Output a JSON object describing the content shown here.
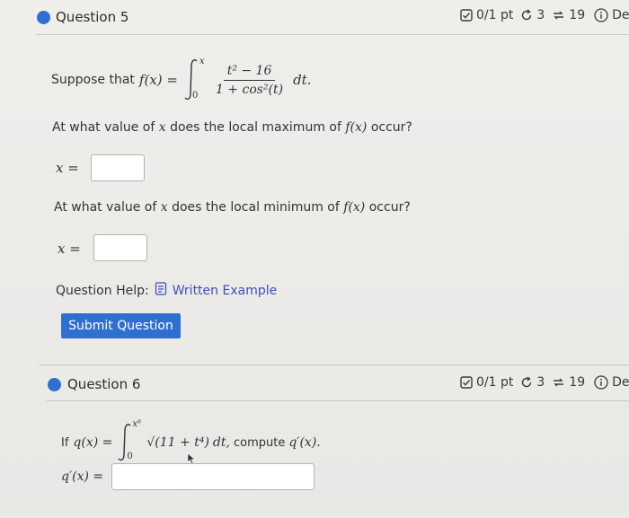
{
  "q5": {
    "title": "Question 5",
    "score": "0/1 pt",
    "retries": "3",
    "attempts": "19",
    "details": "De",
    "prompt_prefix": "Suppose that",
    "func_lhs": "f(x) =",
    "integral_upper": "x",
    "integral_lower": "0",
    "numerator": "t² − 16",
    "denominator": "1 + cos²(t)",
    "dt": "dt.",
    "part_a_prefix": "At what value of",
    "part_a_var": "x",
    "part_a_mid": "does the local maximum of",
    "part_a_fx": "f(x)",
    "part_a_suffix": "occur?",
    "part_b_prefix": "At what value of",
    "part_b_var": "x",
    "part_b_mid": "does the local minimum of",
    "part_b_fx": "f(x)",
    "part_b_suffix": "occur?",
    "answer_label": "x =",
    "answer_a_value": "",
    "answer_b_value": "",
    "help_label": "Question Help:",
    "help_link": "Written Example",
    "submit_label": "Submit Question"
  },
  "q6": {
    "title": "Question 6",
    "score": "0/1 pt",
    "retries": "3",
    "attempts": "19",
    "details": "Deta",
    "prompt_if": "If",
    "func_lhs": "q(x) =",
    "integral_upper": "x⁶",
    "integral_lower": "0",
    "integrand": "√(11 + t⁴)",
    "dt": "dt,",
    "prompt_tail": "compute",
    "target": "q′(x).",
    "answer_label": "q′(x) =",
    "answer_value": ""
  },
  "colors": {
    "accent": "#2f6fd1",
    "link": "#3d4fbf",
    "background": "#ecebe8"
  }
}
